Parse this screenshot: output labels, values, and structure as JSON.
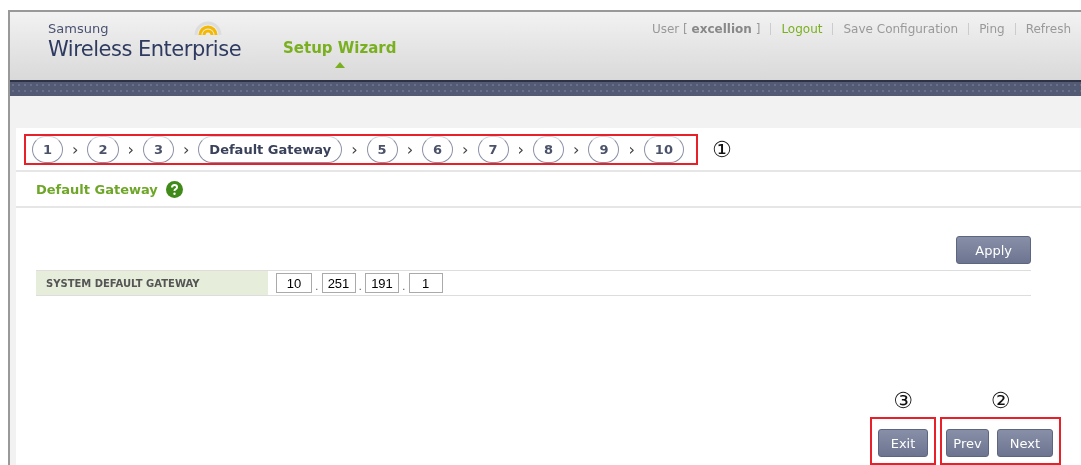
{
  "header": {
    "brand_top": "Samsung",
    "brand_main": "Wireless Enterprise",
    "title": "Setup Wizard",
    "user_label": "User [",
    "user_name": "excellion",
    "user_close": "]",
    "links": [
      {
        "label": "Logout",
        "kind": "accent"
      },
      {
        "label": "Save Configuration",
        "kind": "plain"
      },
      {
        "label": "Ping",
        "kind": "plain"
      },
      {
        "label": "Refresh",
        "kind": "plain"
      }
    ]
  },
  "steps": [
    {
      "label": "1",
      "selected": false
    },
    {
      "label": "2",
      "selected": false
    },
    {
      "label": "3",
      "selected": false
    },
    {
      "label": "Default Gateway",
      "selected": true
    },
    {
      "label": "5",
      "selected": false
    },
    {
      "label": "6",
      "selected": false
    },
    {
      "label": "7",
      "selected": false
    },
    {
      "label": "8",
      "selected": false
    },
    {
      "label": "9",
      "selected": false
    },
    {
      "label": "10",
      "selected": false
    }
  ],
  "step_separator": "›",
  "callouts": {
    "steps": "①",
    "nav": "②",
    "exit": "③"
  },
  "section": {
    "title": "Default Gateway"
  },
  "apply_button": "Apply",
  "field": {
    "label": "SYSTEM DEFAULT GATEWAY",
    "octets": [
      "10",
      "251",
      "191",
      "1"
    ],
    "separator": "."
  },
  "buttons": {
    "exit": "Exit",
    "prev": "Prev",
    "next": "Next"
  }
}
